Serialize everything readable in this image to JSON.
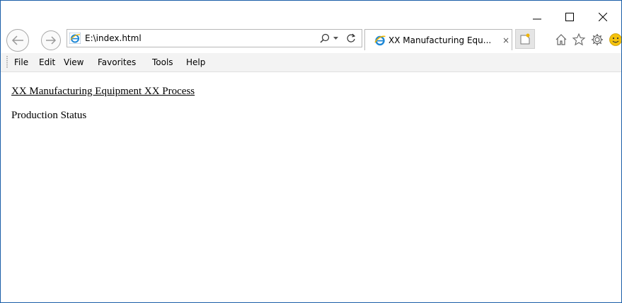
{
  "window": {
    "controls": {
      "minimize_icon": "minimize-icon",
      "maximize_icon": "maximize-icon",
      "close_icon": "close-icon"
    }
  },
  "navigation": {
    "address": "E:\\index.html",
    "address_icon": "ie-icon",
    "search_icon": "search-icon",
    "refresh_icon": "refresh-icon"
  },
  "tab": {
    "title": "XX Manufacturing Equ...",
    "close_label": "×",
    "icon": "ie-icon"
  },
  "toolbar_icons": [
    "home-icon",
    "star-icon",
    "gear-icon",
    "smiley-icon"
  ],
  "menu": {
    "items": [
      "File",
      "Edit",
      "View",
      "Favorites",
      "Tools",
      "Help"
    ]
  },
  "content": {
    "link_text": "XX Manufacturing Equipment XX Process",
    "status_text": "Production Status"
  },
  "colors": {
    "window_border": "#1a5ea8",
    "ie_blue": "#1e88d6",
    "ie_gold": "#f0b400",
    "smiley_yellow": "#f4c20d"
  }
}
